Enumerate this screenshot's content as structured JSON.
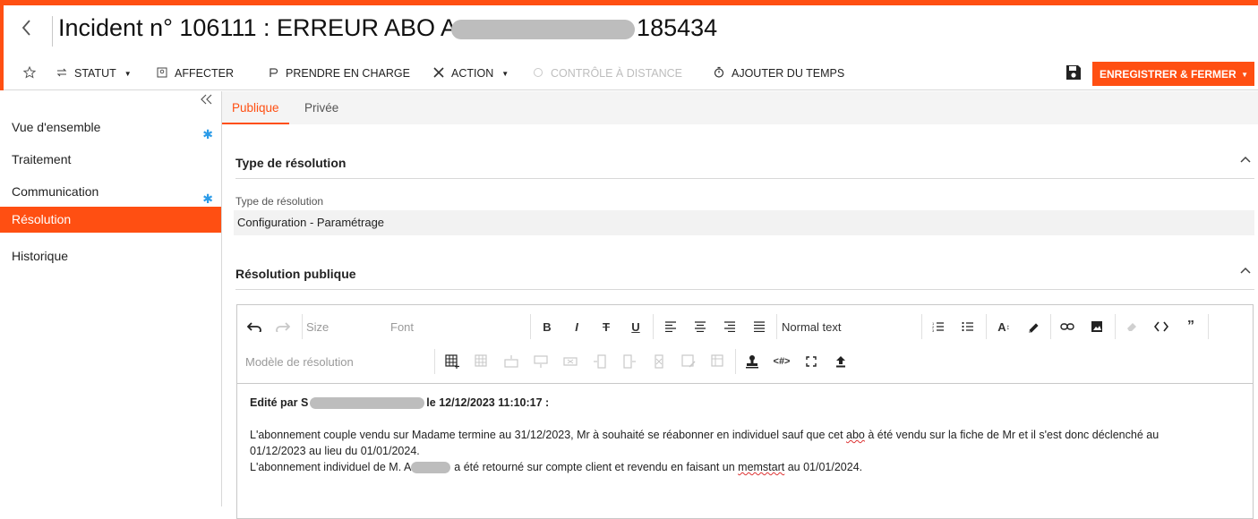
{
  "header": {
    "title_prefix": "Incident n° 106111 : ERREUR ABO A",
    "title_suffix": "185434"
  },
  "commands": {
    "status": "STATUT",
    "assign": "AFFECTER",
    "take_charge": "PRENDRE EN CHARGE",
    "action": "ACTION",
    "remote_control": "CONTRÔLE À DISTANCE",
    "add_time": "AJOUTER DU TEMPS",
    "save_close": "ENREGISTRER & FERMER"
  },
  "sidebar": {
    "items": [
      {
        "label": "Vue d'ensemble",
        "starred": true
      },
      {
        "label": "Traitement",
        "starred": false
      },
      {
        "label": "Communication",
        "starred": true
      },
      {
        "label": "Résolution",
        "starred": false,
        "active": true
      },
      {
        "label": "Historique",
        "starred": false
      }
    ]
  },
  "tabs": [
    {
      "label": "Publique",
      "active": true
    },
    {
      "label": "Privée",
      "active": false
    }
  ],
  "resolution_type": {
    "section_title": "Type de résolution",
    "field_label": "Type de résolution",
    "field_value": "Configuration - Paramétrage"
  },
  "public_resolution": {
    "section_title": "Résolution publique"
  },
  "editor_toolbar": {
    "size_placeholder": "Size",
    "font_placeholder": "Font",
    "paragraph_style": "Normal text",
    "template_placeholder": "Modèle de résolution"
  },
  "editor_content": {
    "edited_prefix": "Edité par S",
    "edited_suffix": "le 12/12/2023 11:10:17 :",
    "line1_a": "L'abonnement couple vendu sur Madame termine au 31/12/2023, Mr à souhaité se réabonner en individuel sauf que cet ",
    "line1_b": "abo",
    "line1_c": " à été vendu sur la fiche de Mr et il s'est donc déclenché au",
    "line2": "01/12/2023 au lieu du 01/01/2024.",
    "line3_a": "L'abonnement individuel de M. A",
    "line3_b": "a été retourné sur compte client et revendu en faisant un ",
    "line3_c": "memstart",
    "line3_d": " au 01/01/2024."
  },
  "colors": {
    "accent": "#ff4f12",
    "star": "#2b9be8"
  }
}
